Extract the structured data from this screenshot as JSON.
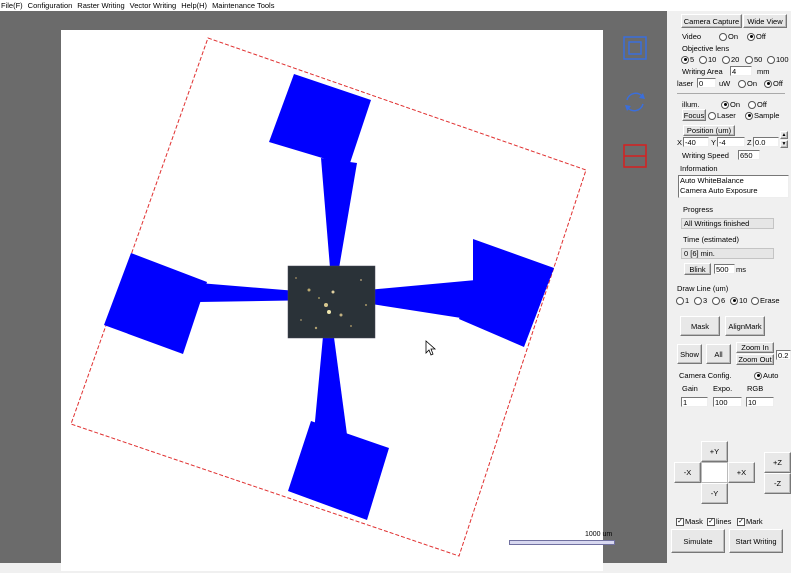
{
  "menu": [
    "File(F)",
    "Configuration",
    "Raster Writing",
    "Vector Writing",
    "Help(H)",
    "Maintenance Tools"
  ],
  "canvas": {
    "scale_label": "1000 um",
    "icons": [
      "fit-view-icon",
      "rotate-icon",
      "fit-width-icon"
    ],
    "colors": {
      "pattern": "#0000ff",
      "boundary": "#e03030"
    }
  },
  "panel": {
    "camera_capture": "Camera Capture",
    "wide_view": "Wide View",
    "video_label": "Video",
    "video_on": "On",
    "video_off": "Off",
    "objective_label": "Objective lens",
    "objectives": [
      "5",
      "10",
      "20",
      "50",
      "100"
    ],
    "writing_area_label": "Writing Area",
    "writing_area_value": "4",
    "writing_area_unit": "mm",
    "laser_label": "laser",
    "laser_value": "0",
    "laser_unit": "uW",
    "laser_on": "On",
    "laser_off": "Off",
    "illum_label": "illum.",
    "illum_on": "On",
    "illum_off": "Off",
    "focus_btn": "Focus",
    "focus_laser": "Laser",
    "focus_sample": "Sample",
    "position_btn": "Position (um)",
    "x_label": "X",
    "x_value": "-40",
    "y_label": "Y",
    "y_value": "-4",
    "z_label": "Z",
    "z_value": "0.0",
    "speed_label": "Writing Speed",
    "speed_value": "650",
    "info_label": "Information",
    "info_lines": [
      "Auto WhiteBalance",
      "Camera Auto Exposure"
    ],
    "progress_label": "Progress",
    "progress_value": "All Writings finished",
    "time_label": "Time (estimated)",
    "time_value": "0 [6] min.",
    "blink_btn": "Blink",
    "blink_value": "500",
    "blink_unit": "ms",
    "drawline_label": "Draw Line (um)",
    "drawline_options": [
      "1",
      "3",
      "6",
      "10",
      "Erase"
    ],
    "mask_btn": "Mask",
    "alignmark_btn": "AlignMark",
    "show_btn": "Show",
    "all_btn": "All",
    "zoom_in_btn": "Zoom In",
    "zoom_out_btn": "Zoom Out",
    "zoom_value": "0.2",
    "camconfig_label": "Camera Config.",
    "auto_label": "Auto",
    "gain_label": "Gain",
    "expo_label": "Expo.",
    "rgb_label": "RGB",
    "gain_value": "1",
    "expo_value": "100",
    "rgb_value": "10",
    "jog_up": "+Y",
    "jog_left": "-X",
    "jog_right": "+X",
    "jog_down": "-Y",
    "z_up": "+Z",
    "z_down": "-Z",
    "mask_chk": "Mask",
    "lines_chk": "lines",
    "mark_chk": "Mark",
    "simulate_btn": "Simulate",
    "start_btn": "Start Writing"
  }
}
